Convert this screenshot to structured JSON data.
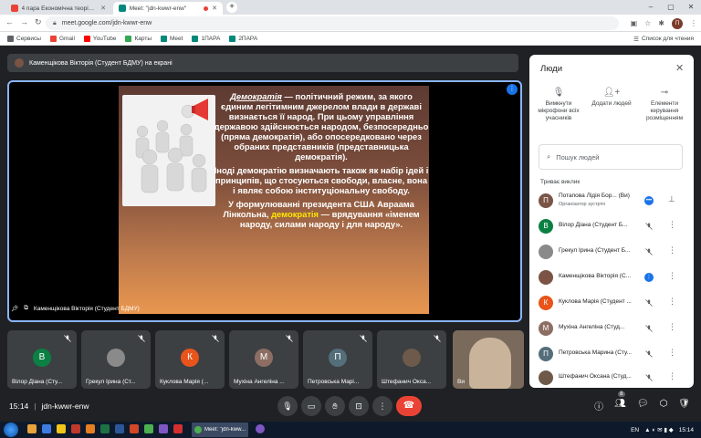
{
  "browser": {
    "tabs": [
      {
        "title": "4 пара Економічна теорія (2 ку",
        "icon": "gmail-icon",
        "active": false
      },
      {
        "title": "Meet: \"jdn-kwwr-enw\"",
        "icon": "meet-icon",
        "active": true
      }
    ],
    "url": "meet.google.com/jdn-kwwr-enw",
    "profile_initial": "П",
    "bookmarks": [
      {
        "label": "Сервисы",
        "color": "#5f6368"
      },
      {
        "label": "Gmail",
        "color": "#ea4335"
      },
      {
        "label": "YouTube",
        "color": "#ff0000"
      },
      {
        "label": "Карты",
        "color": "#34a853"
      },
      {
        "label": "Meet",
        "color": "#00897b"
      },
      {
        "label": "1ПАРА",
        "color": "#00897b"
      },
      {
        "label": "2ПАРА",
        "color": "#00897b"
      }
    ],
    "reading_list": "Список для чтения"
  },
  "meet": {
    "presenter_bar": "Каменщікова Вікторія (Студент БДМУ) на екрані",
    "stage_caption": "Каменщікова Вікторія (Студент БДМУ)",
    "slide": {
      "p1_term": "Демократія",
      "p1_rest": " — політичний режим, за якого єдиним легітимним джерелом влади в державі визнається її народ. При цьому управління державою здійснюється народом, безпосередньо (пряма демократія), або опосередковано через обраних представників (представницька демократія).",
      "p2": "Іноді демократію визначають також як набір ідей і принципів, що стосуються свободи, власне, вона і являє собою інституціональну свободу.",
      "p3_a": "У формулюванні президента США Авраама Лінкольна, ",
      "p3_hl": "демократія",
      "p3_b": " — врядування «іменем народу, силами народу і для народу»."
    },
    "tiles": [
      {
        "name": "Вілор Діана (Сту...",
        "initial": "В",
        "color": "#0b8043"
      },
      {
        "name": "Грекул Ірина (Ст...",
        "initial": "",
        "color": "#8a8a8a"
      },
      {
        "name": "Куклова Марія (...",
        "initial": "К",
        "color": "#e8541b"
      },
      {
        "name": "Мухіна Ангеліна ...",
        "initial": "М",
        "color": "#8d6e63"
      },
      {
        "name": "Петровська Марі...",
        "initial": "П",
        "color": "#546e7a"
      },
      {
        "name": "Штефанич Окса...",
        "initial": "",
        "color": "#6d5a4a"
      },
      {
        "name": "Ви",
        "initial": "",
        "color": "#d9c6b0"
      }
    ],
    "time": "15:14",
    "meeting_code": "jdn-kwwr-enw",
    "participant_count": "8"
  },
  "people_panel": {
    "title": "Люди",
    "actions": [
      {
        "label": "Вимкнути мікрофони всіх учасників"
      },
      {
        "label": "Додати людей"
      },
      {
        "label": "Елементи керування розміщенням"
      }
    ],
    "search_placeholder": "Пошук людей",
    "section_title": "Триває виклик",
    "participants": [
      {
        "name": "Потапова Лідія Бор...",
        "tag": "(Ви)",
        "sub": "Організатор зустрічі",
        "initial": "П",
        "color": "#795548",
        "mic": "speaking"
      },
      {
        "name": "Вілор Діана (Студент Б...",
        "initial": "В",
        "color": "#0b8043",
        "mic": "muted"
      },
      {
        "name": "Грекул Ірина (Студент Б...",
        "initial": "",
        "color": "#8a8a8a",
        "mic": "muted"
      },
      {
        "name": "Каменщікова Вікторія (С...",
        "initial": "",
        "color": "#7b5446",
        "mic": "active"
      },
      {
        "name": "Куклова Марія (Студент ...",
        "initial": "К",
        "color": "#e8541b",
        "mic": "muted"
      },
      {
        "name": "Мухіна Ангеліна (Студ...",
        "initial": "М",
        "color": "#8d6e63",
        "mic": "muted"
      },
      {
        "name": "Петровська Марина (Сту...",
        "initial": "П",
        "color": "#546e7a",
        "mic": "muted"
      },
      {
        "name": "Штефанич Оксана (Студ...",
        "initial": "",
        "color": "#6d5a4a",
        "mic": "muted"
      }
    ]
  },
  "taskbar": {
    "chrome_label": "Meet: \"jdn-kww...",
    "lang": "EN",
    "clock": "15:14"
  }
}
